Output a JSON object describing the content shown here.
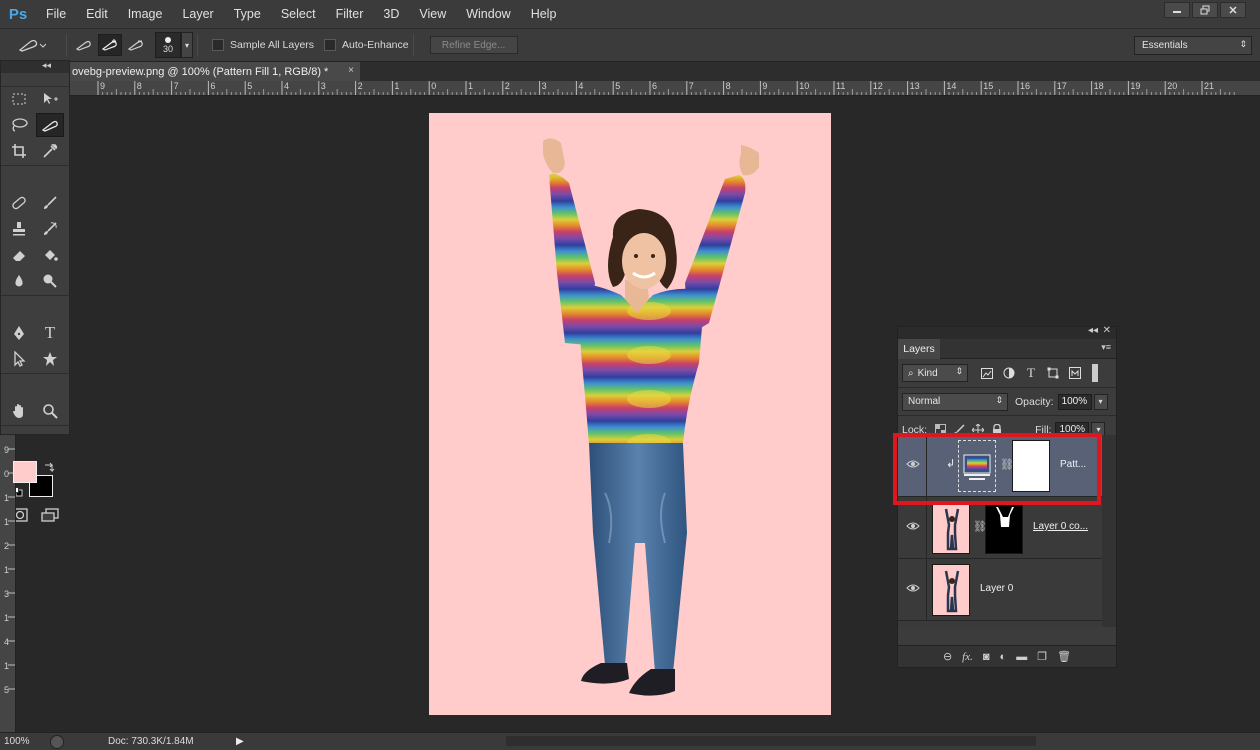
{
  "app": {
    "logo": "Ps",
    "menu": [
      "File",
      "Edit",
      "Image",
      "Layer",
      "Type",
      "Select",
      "Filter",
      "3D",
      "View",
      "Window",
      "Help"
    ],
    "window_controls": [
      "minimize-icon",
      "restore-icon",
      "close-icon"
    ]
  },
  "options_bar": {
    "brush_size": "30",
    "sample_all_layers": "Sample All Layers",
    "auto_enhance": "Auto-Enhance",
    "refine_edge": "Refine Edge...",
    "workspace": "Essentials"
  },
  "document_tab": {
    "title": "ovebg-preview.png @ 100% (Pattern Fill 1, RGB/8) *",
    "close": "×"
  },
  "ruler_h": [
    "9",
    "8",
    "7",
    "6",
    "5",
    "4",
    "3",
    "2",
    "1",
    "0",
    "1",
    "2",
    "3",
    "4",
    "5",
    "6",
    "7",
    "8",
    "9",
    "10",
    "11",
    "12",
    "13",
    "14",
    "15",
    "16",
    "17",
    "18",
    "19",
    "20",
    "21"
  ],
  "ruler_v": [
    "9",
    "0",
    "1",
    "1",
    "2",
    "1",
    "3",
    "1",
    "4",
    "1",
    "5"
  ],
  "tools": {
    "collapse": "◂◂",
    "close": "✕",
    "items": [
      "marquee-icon",
      "move-icon",
      "lasso-icon",
      "quick-selection-icon",
      "crop-icon",
      "eyedropper-icon",
      "healing-brush-icon",
      "brush-icon",
      "clone-stamp-icon",
      "history-brush-icon",
      "eraser-icon",
      "paint-bucket-icon",
      "blur-icon",
      "dodge-icon",
      "pen-icon",
      "type-icon",
      "path-selection-icon",
      "shape-icon",
      "hand-icon",
      "zoom-icon"
    ],
    "foreground_color": "#ffcccb",
    "background_color": "#000000"
  },
  "status": {
    "zoom": "100%",
    "doc": "Doc: 730.3K/1.84M",
    "arrow": "▶"
  },
  "layers_panel": {
    "tab": "Layers",
    "filter_kind": "Kind",
    "blend_mode": "Normal",
    "opacity_label": "Opacity:",
    "opacity_value": "100%",
    "lock_label": "Lock:",
    "fill_label": "Fill:",
    "fill_value": "100%",
    "layers": [
      {
        "name": "Patt...",
        "selected": true,
        "type": "pattern-fill"
      },
      {
        "name": "Layer 0 co...",
        "selected": false,
        "type": "masked-copy"
      },
      {
        "name": "Layer 0",
        "selected": false,
        "type": "image"
      }
    ],
    "bottom_icons": [
      "link-layers-icon",
      "fx-icon",
      "add-mask-icon",
      "adjustment-layer-icon",
      "new-group-icon",
      "new-layer-icon",
      "trash-icon"
    ]
  },
  "document": {
    "background_color": "#ffcccb"
  },
  "colors": {
    "accent_highlight": "#e0161f",
    "selected_layer": "#586176",
    "logo": "#4aa8e8"
  }
}
